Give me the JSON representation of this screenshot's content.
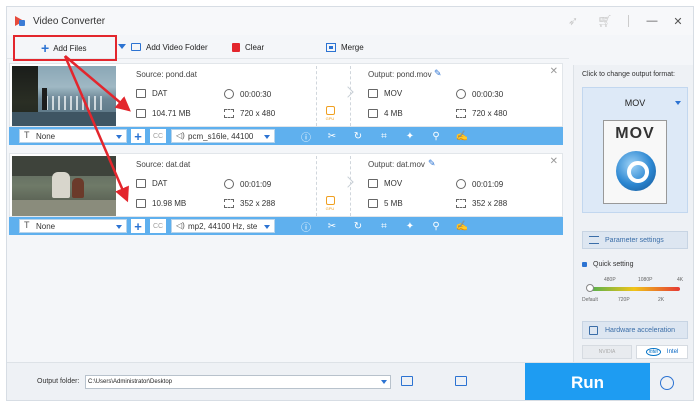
{
  "window": {
    "title": "Video Converter"
  },
  "toolbar": {
    "add_files": "Add Files",
    "add_video_folder": "Add Video Folder",
    "clear": "Clear",
    "merge": "Merge"
  },
  "files": [
    {
      "source_label": "Source: pond.dat",
      "output_label": "Output: pond.mov",
      "src_format": "DAT",
      "src_duration": "00:00:30",
      "src_size": "104.71 MB",
      "src_resolution": "720 x 480",
      "out_format": "MOV",
      "out_duration": "00:00:30",
      "out_size": "4 MB",
      "out_resolution": "720 x 480",
      "subtitle": "None",
      "audio": "pcm_s16le, 44100"
    },
    {
      "source_label": "Source: dat.dat",
      "output_label": "Output: dat.mov",
      "src_format": "DAT",
      "src_duration": "00:01:09",
      "src_size": "10.98 MB",
      "src_resolution": "352 x 288",
      "out_format": "MOV",
      "out_duration": "00:01:09",
      "out_size": "5 MB",
      "out_resolution": "352 x 288",
      "subtitle": "None",
      "audio": "mp2, 44100 Hz, ste"
    }
  ],
  "gpu_label": "GPU",
  "cc_label": "CC",
  "right_panel": {
    "title": "Click to change output format:",
    "format": "MOV",
    "icon_text": "MOV",
    "parameter_settings": "Parameter settings",
    "quick_setting": "Quick setting",
    "quality_top": [
      "480P",
      "1080P",
      "4K"
    ],
    "quality_bottom": [
      "Default",
      "720P",
      "2K"
    ],
    "quality_level": 0,
    "hardware_acceleration": "Hardware acceleration",
    "nvidia": "NVIDIA",
    "intel": "Intel",
    "intel_logo": "intel"
  },
  "bottom": {
    "output_folder_label": "Output folder:",
    "output_path": "C:\\Users\\Administrator\\Desktop",
    "run": "Run"
  },
  "colors": {
    "accent": "#2c73d2",
    "highlight_red": "#e3262d",
    "edit_bar": "#5fb0ee",
    "run_button": "#1e9cf2",
    "gpu": "#f0a020"
  }
}
